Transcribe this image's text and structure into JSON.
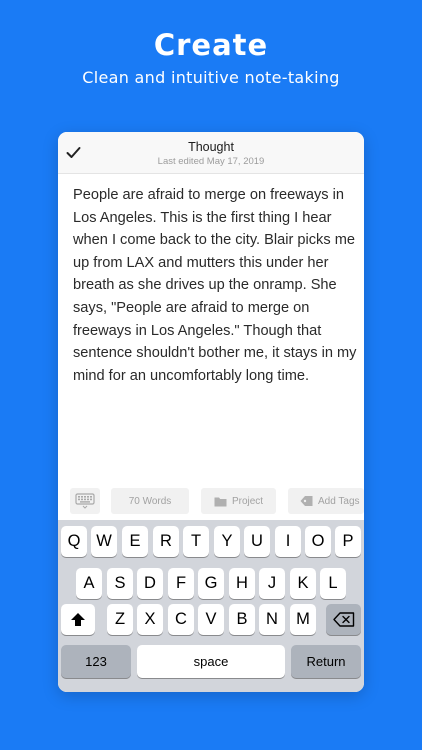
{
  "hero": {
    "title": "Create",
    "subtitle": "Clean and intuitive note-taking"
  },
  "nav": {
    "title": "Thought",
    "subtitle": "Last edited May 17, 2019",
    "done_icon": "checkmark-icon"
  },
  "note": {
    "body": "People are afraid to merge on freeways in Los Angeles. This is the first thing I hear when I come back to the city. Blair picks me up from LAX and mutters this under her breath as she drives up the onramp. She says, \"People are afraid to merge on freeways in Los Angeles.\" Though that sentence shouldn't bother me, it stays in my mind for an uncomfortably long time."
  },
  "toolbar": {
    "keyboard_icon": "keyboard-icon",
    "word_count": "70 Words",
    "project_label": "Project",
    "project_icon": "folder-icon",
    "tags_label": "Add Tags",
    "tags_icon": "tag-icon"
  },
  "keyboard": {
    "row1": [
      "Q",
      "W",
      "E",
      "R",
      "T",
      "Y",
      "U",
      "I",
      "O",
      "P"
    ],
    "row2": [
      "A",
      "S",
      "D",
      "F",
      "G",
      "H",
      "J",
      "K",
      "L"
    ],
    "row3": [
      "Z",
      "X",
      "C",
      "V",
      "B",
      "N",
      "M"
    ],
    "shift_icon": "shift-icon",
    "delete_icon": "backspace-icon",
    "numbers_label": "123",
    "space_label": "space",
    "return_label": "Return"
  },
  "colors": {
    "background": "#1a7bf5",
    "keyboard_bg": "#d2d5db",
    "key": "#ffffff",
    "system_key": "#adb3bc"
  }
}
